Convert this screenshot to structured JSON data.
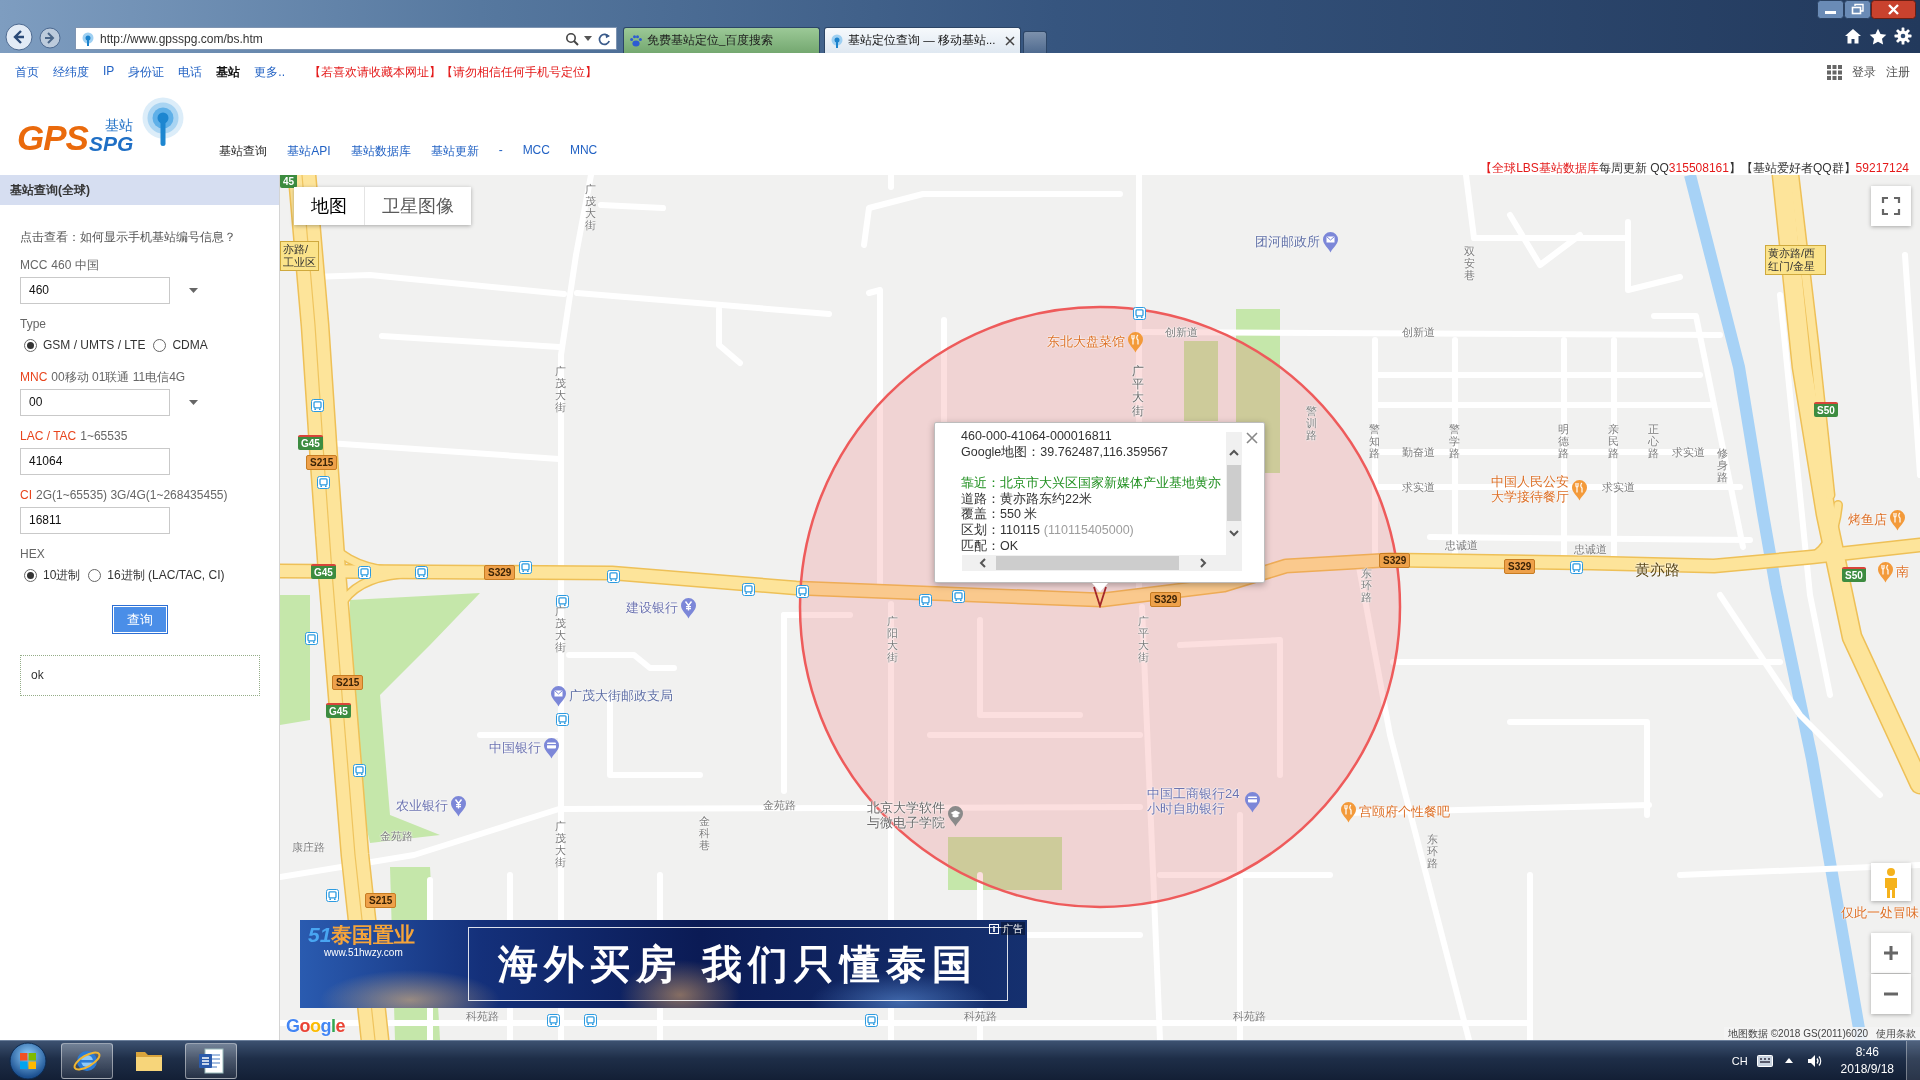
{
  "browser": {
    "address": "http://www.gpsspg.com/bs.htm",
    "tabs": [
      {
        "title": "免费基站定位_百度搜索",
        "selected": false
      },
      {
        "title": "基站定位查询 — 移动基站...",
        "selected": true
      }
    ]
  },
  "site_nav": {
    "links": [
      {
        "label": "首页",
        "selected": false
      },
      {
        "label": "经纬度",
        "selected": false
      },
      {
        "label": "IP",
        "selected": false
      },
      {
        "label": "身份证",
        "selected": false
      },
      {
        "label": "电话",
        "selected": false
      },
      {
        "label": "基站",
        "selected": true
      },
      {
        "label": "更多..",
        "selected": false
      }
    ],
    "notices": [
      "【若喜欢请收藏本网址】",
      "【请勿相信任何手机号定位】"
    ],
    "account_links": [
      "登录",
      "注册"
    ]
  },
  "logo": {
    "brand": "GPS",
    "brand_2": "SPG",
    "tagline": "基站"
  },
  "main_nav": [
    {
      "label": "基站查询",
      "kind": "link",
      "selected": true
    },
    {
      "label": "基站API",
      "kind": "link",
      "selected": false
    },
    {
      "label": "基站数据库",
      "kind": "link",
      "selected": false
    },
    {
      "label": "基站更新",
      "kind": "link",
      "selected": false
    },
    {
      "label": "-",
      "kind": "separator"
    },
    {
      "label": "MCC",
      "kind": "link",
      "selected": false
    },
    {
      "label": "MNC",
      "kind": "link",
      "selected": false
    }
  ],
  "announcement": [
    {
      "text": "【全球LBS基站数据库",
      "highlight": true
    },
    {
      "text": "每周更新 QQ",
      "highlight": false
    },
    {
      "text": "315508161",
      "highlight": true
    },
    {
      "text": "】【基站爱好者QQ群】",
      "highlight": false
    },
    {
      "text": "59217124",
      "highlight": true
    }
  ],
  "query_panel": {
    "title": "基站查询(全球)",
    "help_link": "点击查看：如何显示手机基站编号信息？",
    "fields": [
      {
        "kind": "select",
        "key": "MCC",
        "hint": "460 中国",
        "required": false,
        "value": "460"
      },
      {
        "kind": "radio",
        "key": "Type",
        "required": false,
        "options": [
          {
            "label": "GSM / UMTS / LTE",
            "selected": true
          },
          {
            "label": "CDMA",
            "selected": false
          }
        ]
      },
      {
        "kind": "select",
        "key": "MNC",
        "hint": "00移动 01联通 11电信4G",
        "required": true,
        "value": "00"
      },
      {
        "kind": "input",
        "key": "LAC / TAC",
        "hint": "1~65535",
        "required": true,
        "value": "41064"
      },
      {
        "kind": "input",
        "key": "CI",
        "hint": "2G(1~65535) 3G/4G(1~268435455)",
        "required": true,
        "value": "16811"
      },
      {
        "kind": "radio",
        "key": "HEX",
        "required": false,
        "options": [
          {
            "label": "10进制",
            "selected": true
          },
          {
            "label": "16进制 (LAC/TAC, CI)",
            "selected": false
          }
        ]
      }
    ],
    "submit": "查询",
    "result": "ok"
  },
  "map": {
    "map_types": [
      {
        "label": "地图",
        "selected": true
      },
      {
        "label": "卫星图像",
        "selected": false
      }
    ],
    "labels": [
      {
        "text": "45",
        "kind": "route-g"
      },
      {
        "text": "亦路/工业区",
        "kind": "exit"
      },
      {
        "text": "广茂大街",
        "kind": "road"
      },
      {
        "text": "团河邮政所",
        "kind": "post"
      },
      {
        "text": "双安巷",
        "kind": "road"
      },
      {
        "text": "黄亦路/西红门/金星",
        "kind": "exit"
      },
      {
        "text": "东北大盘菜馆",
        "kind": "restaurant"
      },
      {
        "text": "创新道",
        "kind": "road"
      },
      {
        "text": "创新道",
        "kind": "road"
      },
      {
        "text": "G45",
        "kind": "route-g"
      },
      {
        "text": "S215",
        "kind": "route-s"
      },
      {
        "text": "广茂大街",
        "kind": "road"
      },
      {
        "text": "广平大街",
        "kind": "road"
      },
      {
        "text": "警训路",
        "kind": "road"
      },
      {
        "text": "警知路",
        "kind": "road"
      },
      {
        "text": "勤奋道",
        "kind": "road"
      },
      {
        "text": "警学路",
        "kind": "road"
      },
      {
        "text": "明德路",
        "kind": "road"
      },
      {
        "text": "亲民路",
        "kind": "road"
      },
      {
        "text": "正心路",
        "kind": "road"
      },
      {
        "text": "求实道",
        "kind": "road"
      },
      {
        "text": "修身路",
        "kind": "road"
      },
      {
        "text": "S50",
        "kind": "route-g"
      },
      {
        "text": "求实道",
        "kind": "road"
      },
      {
        "text": "中国人民公安大学接待餐厅",
        "kind": "restaurant"
      },
      {
        "text": "求实道",
        "kind": "road"
      },
      {
        "text": "烤鱼店",
        "kind": "restaurant"
      },
      {
        "text": "G45",
        "kind": "route-g"
      },
      {
        "text": "S329",
        "kind": "route-s"
      },
      {
        "text": "东环路",
        "kind": "road"
      },
      {
        "text": "S329",
        "kind": "route-s"
      },
      {
        "text": "忠诚道",
        "kind": "road"
      },
      {
        "text": "S329",
        "kind": "route-s"
      },
      {
        "text": "忠诚道",
        "kind": "road"
      },
      {
        "text": "黄亦路",
        "kind": "main-road"
      },
      {
        "text": "S50",
        "kind": "route-g"
      },
      {
        "text": "南",
        "kind": "restaurant"
      },
      {
        "text": "广茂大街",
        "kind": "road"
      },
      {
        "text": "建设银行",
        "kind": "bank"
      },
      {
        "text": "广阳大街",
        "kind": "road"
      },
      {
        "text": "广平大街",
        "kind": "road"
      },
      {
        "text": "S329",
        "kind": "route-s"
      },
      {
        "text": "G45",
        "kind": "route-g"
      },
      {
        "text": "S215",
        "kind": "route-s"
      },
      {
        "text": "广茂大街邮政支局",
        "kind": "post"
      },
      {
        "text": "中国银行",
        "kind": "atm"
      },
      {
        "text": "康庄路",
        "kind": "road"
      },
      {
        "text": "金苑路",
        "kind": "road"
      },
      {
        "text": "农业银行",
        "kind": "bank"
      },
      {
        "text": "广茂大街",
        "kind": "road"
      },
      {
        "text": "金科巷",
        "kind": "road"
      },
      {
        "text": "金苑路",
        "kind": "road"
      },
      {
        "text": "北京大学软件与微电子学院",
        "kind": "school"
      },
      {
        "text": "中国工商银行24小时自助银行",
        "kind": "atm"
      },
      {
        "text": "宫颐府个性餐吧",
        "kind": "restaurant"
      },
      {
        "text": "东环路",
        "kind": "road"
      },
      {
        "text": "S215",
        "kind": "route-s"
      },
      {
        "text": "仅此一处冒味",
        "kind": "restaurant"
      },
      {
        "text": "科苑路",
        "kind": "road"
      },
      {
        "text": "科苑路",
        "kind": "road"
      },
      {
        "text": "科苑路",
        "kind": "road"
      }
    ],
    "info_window": {
      "cell_id": "460-000-41064-000016811",
      "coords": "Google地图：39.762487,116.359567",
      "near": "靠近：北京市大兴区国家新媒体产业基地黄亦",
      "road": "道路：黄亦路东约22米",
      "coverage": "覆盖：550 米",
      "district": "区划：110115",
      "district_code": "(110115405000)",
      "match": "匹配：OK"
    },
    "ad_banner": {
      "brand_number": "51",
      "brand": "泰国置业",
      "url": "www.51hwzy.com",
      "slogan": "海外买房 我们只懂泰国",
      "badge": "广告"
    },
    "google_logo": "Google",
    "attribution": "地图数据 ©2018 GS(2011)6020",
    "terms": "使用条款"
  },
  "taskbar": {
    "apps": [
      {
        "kind": "browser",
        "running": true
      },
      {
        "kind": "folder",
        "running": false
      },
      {
        "kind": "word",
        "running": true
      }
    ],
    "language": "CH",
    "time": "8:46",
    "date": "2018/9/18"
  }
}
